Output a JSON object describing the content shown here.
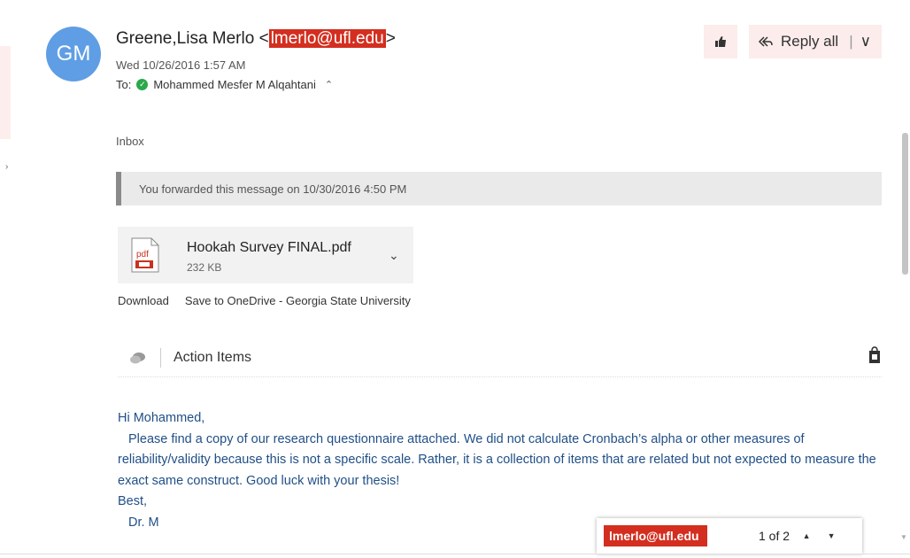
{
  "email": {
    "avatar_initials": "GM",
    "sender_name": "Greene,Lisa Merlo",
    "sender_email": "lmerlo@ufl.edu",
    "date": "Wed 10/26/2016 1:57 AM",
    "to_label": "To:",
    "to_name": "Mohammed Mesfer M Alqahtani",
    "folder": "Inbox",
    "forward_note": "You forwarded this message on 10/30/2016 4:50 PM"
  },
  "toolbar": {
    "reply_all_label": "Reply all"
  },
  "attachment": {
    "name": "Hookah Survey FINAL.pdf",
    "size": "232 KB",
    "icon_text": "pdf",
    "download_label": "Download",
    "save_label": "Save to OneDrive - Georgia State University"
  },
  "actions": {
    "label": "Action Items"
  },
  "body": {
    "greeting": "Hi Mohammed,",
    "paragraph": "Please find a copy of our research questionnaire attached.  We did not calculate Cronbach’s alpha or other measures of reliability/validity because this is not a specific scale. Rather, it is a collection of items that are related but not expected to measure the exact same construct. Good luck with your thesis!",
    "closing": "Best,",
    "signature": "Dr. M"
  },
  "find": {
    "query": "lmerlo@ufl.edu",
    "count": "1 of 2"
  },
  "colors": {
    "highlight": "#d32e1f",
    "avatar": "#5f9ee4",
    "body_text": "#1f4f87",
    "button_bg": "#fcecec"
  }
}
